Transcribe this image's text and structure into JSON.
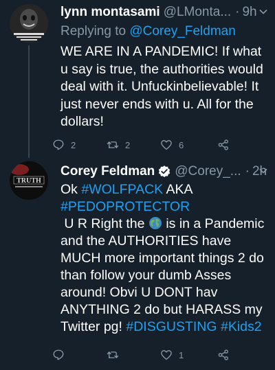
{
  "tweets": [
    {
      "display_name": "lynn montasami",
      "handle": "@LMonta...",
      "separator": "·",
      "time": "9h",
      "reply_prefix": "Replying to",
      "reply_to": "@Corey_Feldman",
      "text": "WE ARE IN A PANDEMIC! If what u say is true, the authorities would deal with it. Unfuckinbelievable! It just never ends with u. All for the dollars!",
      "replies": "2",
      "retweets": "2",
      "likes": "6"
    },
    {
      "display_name": "Corey Feldman",
      "verified": true,
      "handle": "@Corey_...",
      "separator": "·",
      "time": "2h",
      "text_1": "Ok",
      "hashtag_1": "#WOLFPACK",
      "text_2": "AKA",
      "hashtag_2": "#PEDOPROTECTOR",
      "text_3": " U R Right the",
      "text_4": "is in a Pandemic and the AUTHORITIES have MUCH more important things 2 do than follow your dumb Asses around! Obvi U DONT hav ANYTHING 2 do but HARASS my Twitter pg!",
      "hashtag_3": "#DISGUSTING",
      "hashtag_4": "#Kids2",
      "replies": "",
      "retweets": "",
      "likes": "1"
    }
  ],
  "colors": {
    "background": "#15202b",
    "accent": "#1da1f2",
    "secondary_text": "#8899a6"
  },
  "icons": [
    "reply-icon",
    "retweet-icon",
    "like-icon",
    "share-icon",
    "verified-badge-icon",
    "globe-emoji-icon",
    "chevron-down-icon"
  ]
}
